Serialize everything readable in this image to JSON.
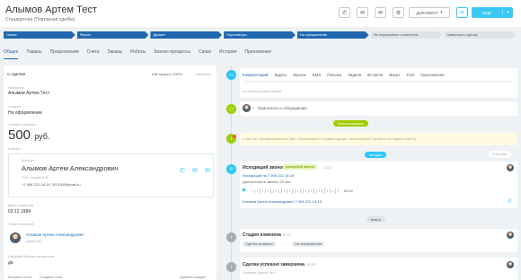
{
  "header": {
    "title": "Алымов Артем Тест",
    "subtitle": "Стандартная (Повторная сделка)",
    "document_label": "ДОКУМЕНТ",
    "main_button_label": "ЕЩЁ"
  },
  "stages": [
    {
      "label": "Новая",
      "state": "done"
    },
    {
      "label": "Расчет",
      "state": "done"
    },
    {
      "label": "Думает",
      "state": "done"
    },
    {
      "label": "Переговоры",
      "state": "done"
    },
    {
      "label": "На оформлении",
      "state": "current"
    },
    {
      "label": "На подписании с клиентом",
      "state": "pending"
    },
    {
      "label": "Завершить сделку",
      "state": "pending"
    }
  ],
  "tabs": [
    "Общее",
    "Товары",
    "Предложения",
    "Счета",
    "Заказы",
    "Роботы",
    "Бизнес-процессы",
    "Связи",
    "История",
    "Приложения"
  ],
  "left": {
    "section_title": "О СДЕЛКЕ",
    "kpi_text": "А/Б-скорост 100%",
    "edit_label": "изменить",
    "name_label": "Название",
    "name_value": "Алымов Артем Тест",
    "stage_label": "Стадия",
    "stage_value": "На оформлении",
    "sum_label": "Сумма и валюта",
    "sum_amount": "500",
    "sum_currency": "руб.",
    "client_label": "Клиент",
    "contact_label": "Контакт",
    "contact_name": "Алымов Артем Александрович",
    "contact_company": "ЗАО Альфа А.В.",
    "contact_info": "+7 908 222-18-19, 2021918@mail.ru",
    "birth_label": "Дата рождения",
    "birth_value": "02.12.1984",
    "resp_label": "Ответственный",
    "resp_name": "Алымов Артем Александрович",
    "resp_role": "Директор",
    "source_label": "Сводный бизнес-процессов",
    "source_value": "да",
    "foot_select": "Выбрать поле",
    "foot_create": "Создать поле",
    "foot_delete": "Удалить раздел"
  },
  "timeline": {
    "tabs": [
      "Комментарий",
      "Ждать",
      "Звонок",
      "SMS",
      "Письмо",
      "Задача",
      "Встреча",
      "Визит",
      "Fact",
      "Приложение"
    ],
    "comment_placeholder": "Оставить комментарий",
    "invite_text": "Пригласить к обсуждению",
    "scheduled_pill": "Запланировано",
    "scheduled_text": "У вас нет запланированных дел. Переведите в стадию сделки, запланируйте уровень поставки клиенту",
    "today_pill": "сегодня",
    "filter_label": "Фильтр",
    "call_title": "Исходящий звонок",
    "call_badge": "успешный звонок",
    "call_time": "12:37",
    "call_sub": "Исходящий на 7 908 222-18-19",
    "call_duration": "Длительность звонка: 22 сек.",
    "call_audio_time": "00:22",
    "call_contact": "Алымов Артем Александрович 7 908 222-18-19",
    "yesterday_pill": "вчера",
    "stage_change_title": "Стадия изменена",
    "stage_change_time": "18:31",
    "stage_from": "Сделка успешна",
    "stage_to": "На оформлении",
    "success_title": "Сделка успешно завершена",
    "success_time": "18:30",
    "success_sub": "Алымов Артем Тест"
  },
  "colors": {
    "accent": "#3bc8f5",
    "stage_active": "#2067b0",
    "ok": "#9dcf00",
    "info": "#a8adb4",
    "phone": "#2fc6f6"
  }
}
